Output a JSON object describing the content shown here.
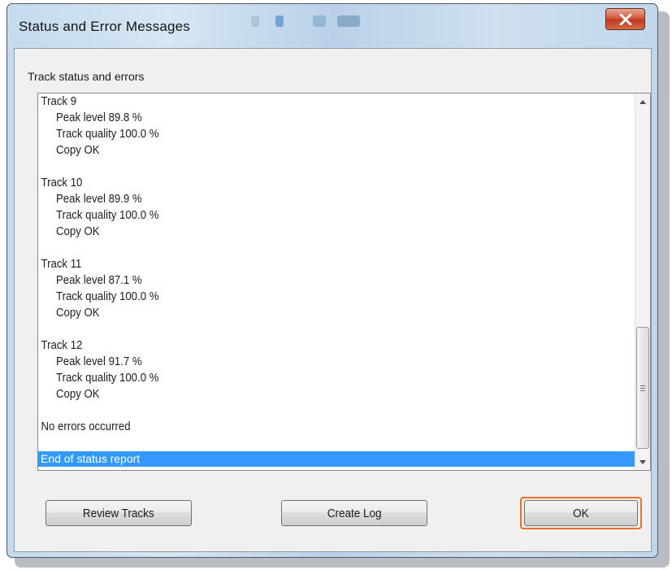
{
  "window": {
    "title": "Status and Error Messages"
  },
  "colors": {
    "selection": "#3399ff",
    "focus_outline": "#e8702a",
    "close_button": "#c1371d"
  },
  "icons": {
    "close": "close-icon",
    "scroll_up": "arrow-up-icon",
    "scroll_down": "arrow-down-icon",
    "scroll_grip": "grip-icon"
  },
  "group_label": "Track status and errors",
  "status_list": {
    "tracks": [
      {
        "head": "Track  9",
        "peak": "Peak level 89.8 %",
        "quality": "Track quality 100.0 %",
        "copy": "Copy OK"
      },
      {
        "head": "Track 10",
        "peak": "Peak level 89.9 %",
        "quality": "Track quality 100.0 %",
        "copy": "Copy OK"
      },
      {
        "head": "Track 11",
        "peak": "Peak level 87.1 %",
        "quality": "Track quality 100.0 %",
        "copy": "Copy OK"
      },
      {
        "head": "Track 12",
        "peak": "Peak level 91.7 %",
        "quality": "Track quality 100.0 %",
        "copy": "Copy OK"
      }
    ],
    "summary": "No errors occurred",
    "selected_line": "End of status report"
  },
  "buttons": {
    "review": "Review Tracks",
    "create_log": "Create Log",
    "ok": "OK"
  }
}
